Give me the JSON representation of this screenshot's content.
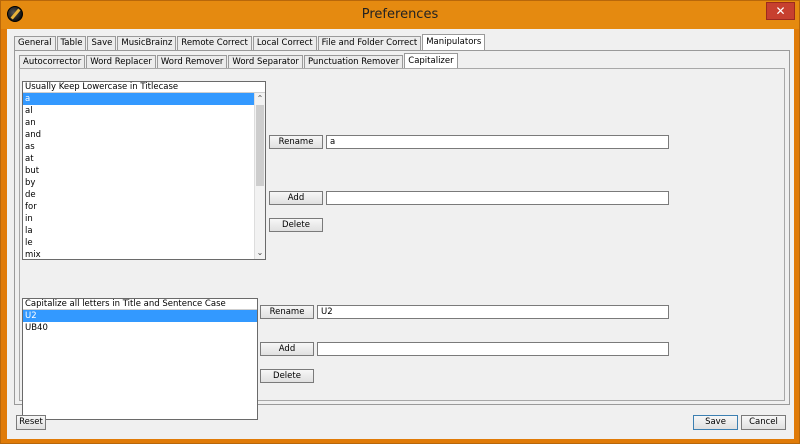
{
  "window": {
    "title": "Preferences",
    "close_glyph": "✕"
  },
  "tabs_top": [
    {
      "label": "General"
    },
    {
      "label": "Table"
    },
    {
      "label": "Save"
    },
    {
      "label": "MusicBrainz"
    },
    {
      "label": "Remote Correct"
    },
    {
      "label": "Local Correct"
    },
    {
      "label": "File and Folder Correct"
    },
    {
      "label": "Manipulators",
      "active": true
    }
  ],
  "tabs_sub": [
    {
      "label": "Autocorrector"
    },
    {
      "label": "Word Replacer"
    },
    {
      "label": "Word Remover"
    },
    {
      "label": "Word Separator"
    },
    {
      "label": "Punctuation Remover"
    },
    {
      "label": "Capitalizer",
      "active": true
    }
  ],
  "lowercase_list": {
    "caption": "Usually Keep Lowercase in Titlecase",
    "items": [
      "a",
      "al",
      "an",
      "and",
      "as",
      "at",
      "but",
      "by",
      "de",
      "for",
      "in",
      "la",
      "le",
      "mix"
    ],
    "selected_index": 0,
    "rename_label": "Rename",
    "rename_value": "a",
    "add_label": "Add",
    "add_value": "",
    "delete_label": "Delete",
    "scroll_up": "⌃",
    "scroll_down": "⌄"
  },
  "capitalize_list": {
    "caption": "Capitalize all letters in Title and Sentence Case",
    "items": [
      "U2",
      "UB40"
    ],
    "selected_index": 0,
    "rename_label": "Rename",
    "rename_value": "U2",
    "add_label": "Add",
    "add_value": "",
    "delete_label": "Delete"
  },
  "footer": {
    "reset_label": "Reset",
    "save_label": "Save",
    "cancel_label": "Cancel"
  }
}
